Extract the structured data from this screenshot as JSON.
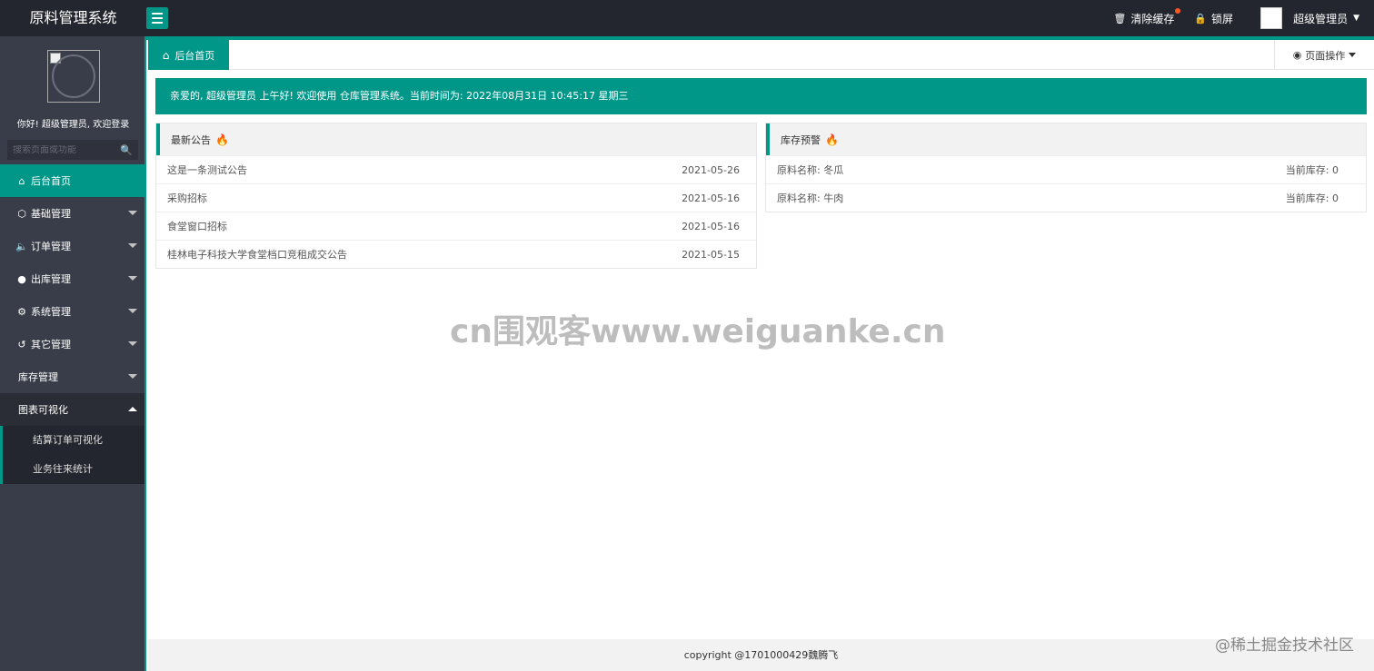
{
  "app": {
    "title": "原料管理系统"
  },
  "topbar": {
    "clear_cache": "清除缓存",
    "lock_screen": "锁屏",
    "user_name": "超级管理员"
  },
  "sidebar": {
    "welcome": "你好!  超级管理员, 欢迎登录",
    "search_placeholder": "搜索页面或功能",
    "items": [
      {
        "label": "后台首页",
        "icon": "home-icon"
      },
      {
        "label": "基础管理",
        "icon": "cube-icon"
      },
      {
        "label": "订单管理",
        "icon": "sound-icon"
      },
      {
        "label": "出库管理",
        "icon": "chat-icon"
      },
      {
        "label": "系统管理",
        "icon": "gear-icon"
      },
      {
        "label": "其它管理",
        "icon": "cycle-icon"
      },
      {
        "label": "库存管理",
        "icon": ""
      },
      {
        "label": "图表可视化",
        "icon": ""
      }
    ],
    "sub_items": [
      {
        "label": "结算订单可视化"
      },
      {
        "label": "业务往来统计"
      }
    ]
  },
  "tabs": {
    "home_tab": "后台首页",
    "page_ops": "页面操作"
  },
  "banner": {
    "text": "亲爱的,  超级管理员 上午好!  欢迎使用 仓库管理系统。当前时间为:   2022年08月31日 10:45:17     星期三"
  },
  "notices": {
    "title": "最新公告",
    "rows": [
      {
        "title": "这是一条测试公告",
        "date": "2021-05-26"
      },
      {
        "title": "采购招标",
        "date": "2021-05-16"
      },
      {
        "title": "食堂窗口招标",
        "date": "2021-05-16"
      },
      {
        "title": "桂林电子科技大学食堂档口竞租成交公告",
        "date": "2021-05-15"
      }
    ]
  },
  "stock_alerts": {
    "title": "库存预警",
    "rows": [
      {
        "name": "原料名称:  冬瓜",
        "stock": "当前库存:  0"
      },
      {
        "name": "原料名称:  牛肉",
        "stock": "当前库存:  0"
      }
    ]
  },
  "watermark": "cn围观客www.weiguanke.cn",
  "footer": {
    "copyright": "copyright @1701000429魏腾飞",
    "platform_mark": "@稀土掘金技术社区"
  },
  "colors": {
    "accent": "#009688",
    "header_bg": "#23262e",
    "sidebar_bg": "#393d49",
    "badge": "#ff5722"
  }
}
